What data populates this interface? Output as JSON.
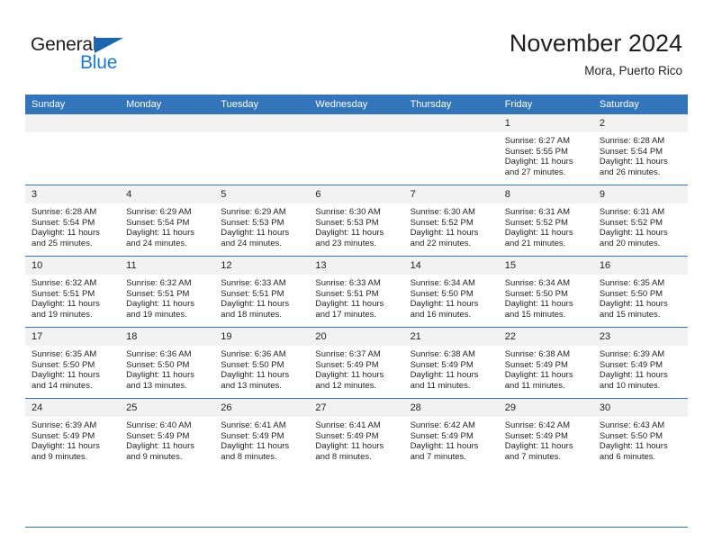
{
  "brand": {
    "name_part1": "General",
    "name_part2": "Blue",
    "triangle_icon": "triangle-icon",
    "colors": {
      "dark": "#231f20",
      "blue": "#1b7ad1",
      "header_blue": "#3275bb",
      "band_gray": "#f2f2f2"
    }
  },
  "header": {
    "title": "November 2024",
    "subtitle": "Mora, Puerto Rico"
  },
  "calendar": {
    "weekday_headers": [
      "Sunday",
      "Monday",
      "Tuesday",
      "Wednesday",
      "Thursday",
      "Friday",
      "Saturday"
    ],
    "weeks": [
      [
        {
          "day": "",
          "empty": true
        },
        {
          "day": "",
          "empty": true
        },
        {
          "day": "",
          "empty": true
        },
        {
          "day": "",
          "empty": true
        },
        {
          "day": "",
          "empty": true
        },
        {
          "day": "1",
          "sunrise": "Sunrise: 6:27 AM",
          "sunset": "Sunset: 5:55 PM",
          "daylight": "Daylight: 11 hours and 27 minutes."
        },
        {
          "day": "2",
          "sunrise": "Sunrise: 6:28 AM",
          "sunset": "Sunset: 5:54 PM",
          "daylight": "Daylight: 11 hours and 26 minutes."
        }
      ],
      [
        {
          "day": "3",
          "sunrise": "Sunrise: 6:28 AM",
          "sunset": "Sunset: 5:54 PM",
          "daylight": "Daylight: 11 hours and 25 minutes."
        },
        {
          "day": "4",
          "sunrise": "Sunrise: 6:29 AM",
          "sunset": "Sunset: 5:54 PM",
          "daylight": "Daylight: 11 hours and 24 minutes."
        },
        {
          "day": "5",
          "sunrise": "Sunrise: 6:29 AM",
          "sunset": "Sunset: 5:53 PM",
          "daylight": "Daylight: 11 hours and 24 minutes."
        },
        {
          "day": "6",
          "sunrise": "Sunrise: 6:30 AM",
          "sunset": "Sunset: 5:53 PM",
          "daylight": "Daylight: 11 hours and 23 minutes."
        },
        {
          "day": "7",
          "sunrise": "Sunrise: 6:30 AM",
          "sunset": "Sunset: 5:52 PM",
          "daylight": "Daylight: 11 hours and 22 minutes."
        },
        {
          "day": "8",
          "sunrise": "Sunrise: 6:31 AM",
          "sunset": "Sunset: 5:52 PM",
          "daylight": "Daylight: 11 hours and 21 minutes."
        },
        {
          "day": "9",
          "sunrise": "Sunrise: 6:31 AM",
          "sunset": "Sunset: 5:52 PM",
          "daylight": "Daylight: 11 hours and 20 minutes."
        }
      ],
      [
        {
          "day": "10",
          "sunrise": "Sunrise: 6:32 AM",
          "sunset": "Sunset: 5:51 PM",
          "daylight": "Daylight: 11 hours and 19 minutes."
        },
        {
          "day": "11",
          "sunrise": "Sunrise: 6:32 AM",
          "sunset": "Sunset: 5:51 PM",
          "daylight": "Daylight: 11 hours and 19 minutes."
        },
        {
          "day": "12",
          "sunrise": "Sunrise: 6:33 AM",
          "sunset": "Sunset: 5:51 PM",
          "daylight": "Daylight: 11 hours and 18 minutes."
        },
        {
          "day": "13",
          "sunrise": "Sunrise: 6:33 AM",
          "sunset": "Sunset: 5:51 PM",
          "daylight": "Daylight: 11 hours and 17 minutes."
        },
        {
          "day": "14",
          "sunrise": "Sunrise: 6:34 AM",
          "sunset": "Sunset: 5:50 PM",
          "daylight": "Daylight: 11 hours and 16 minutes."
        },
        {
          "day": "15",
          "sunrise": "Sunrise: 6:34 AM",
          "sunset": "Sunset: 5:50 PM",
          "daylight": "Daylight: 11 hours and 15 minutes."
        },
        {
          "day": "16",
          "sunrise": "Sunrise: 6:35 AM",
          "sunset": "Sunset: 5:50 PM",
          "daylight": "Daylight: 11 hours and 15 minutes."
        }
      ],
      [
        {
          "day": "17",
          "sunrise": "Sunrise: 6:35 AM",
          "sunset": "Sunset: 5:50 PM",
          "daylight": "Daylight: 11 hours and 14 minutes."
        },
        {
          "day": "18",
          "sunrise": "Sunrise: 6:36 AM",
          "sunset": "Sunset: 5:50 PM",
          "daylight": "Daylight: 11 hours and 13 minutes."
        },
        {
          "day": "19",
          "sunrise": "Sunrise: 6:36 AM",
          "sunset": "Sunset: 5:50 PM",
          "daylight": "Daylight: 11 hours and 13 minutes."
        },
        {
          "day": "20",
          "sunrise": "Sunrise: 6:37 AM",
          "sunset": "Sunset: 5:49 PM",
          "daylight": "Daylight: 11 hours and 12 minutes."
        },
        {
          "day": "21",
          "sunrise": "Sunrise: 6:38 AM",
          "sunset": "Sunset: 5:49 PM",
          "daylight": "Daylight: 11 hours and 11 minutes."
        },
        {
          "day": "22",
          "sunrise": "Sunrise: 6:38 AM",
          "sunset": "Sunset: 5:49 PM",
          "daylight": "Daylight: 11 hours and 11 minutes."
        },
        {
          "day": "23",
          "sunrise": "Sunrise: 6:39 AM",
          "sunset": "Sunset: 5:49 PM",
          "daylight": "Daylight: 11 hours and 10 minutes."
        }
      ],
      [
        {
          "day": "24",
          "sunrise": "Sunrise: 6:39 AM",
          "sunset": "Sunset: 5:49 PM",
          "daylight": "Daylight: 11 hours and 9 minutes."
        },
        {
          "day": "25",
          "sunrise": "Sunrise: 6:40 AM",
          "sunset": "Sunset: 5:49 PM",
          "daylight": "Daylight: 11 hours and 9 minutes."
        },
        {
          "day": "26",
          "sunrise": "Sunrise: 6:41 AM",
          "sunset": "Sunset: 5:49 PM",
          "daylight": "Daylight: 11 hours and 8 minutes."
        },
        {
          "day": "27",
          "sunrise": "Sunrise: 6:41 AM",
          "sunset": "Sunset: 5:49 PM",
          "daylight": "Daylight: 11 hours and 8 minutes."
        },
        {
          "day": "28",
          "sunrise": "Sunrise: 6:42 AM",
          "sunset": "Sunset: 5:49 PM",
          "daylight": "Daylight: 11 hours and 7 minutes."
        },
        {
          "day": "29",
          "sunrise": "Sunrise: 6:42 AM",
          "sunset": "Sunset: 5:49 PM",
          "daylight": "Daylight: 11 hours and 7 minutes."
        },
        {
          "day": "30",
          "sunrise": "Sunrise: 6:43 AM",
          "sunset": "Sunset: 5:50 PM",
          "daylight": "Daylight: 11 hours and 6 minutes."
        }
      ]
    ]
  }
}
